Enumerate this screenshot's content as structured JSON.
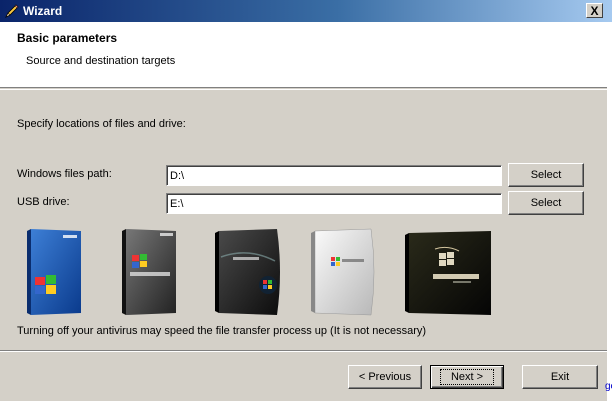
{
  "window": {
    "title": "Wizard",
    "close_label": "X"
  },
  "header": {
    "title": "Basic parameters",
    "subtitle": "Source and destination targets"
  },
  "instructions": "Specify locations of files and drive:",
  "fields": {
    "windows_path": {
      "label": "Windows files path:",
      "value": "D:\\"
    },
    "usb_drive": {
      "label": "USB drive:",
      "value": "E:\\"
    }
  },
  "select_label": "Select",
  "boxes": [
    {
      "name": "windows-xp-box",
      "lettering": "Windows XP"
    },
    {
      "name": "windows-server-2003-box",
      "lettering": "Windows Server 2003"
    },
    {
      "name": "windows-vista-box",
      "lettering": "Windows Vista"
    },
    {
      "name": "windows-server-2008-box",
      "lettering": "Windows Server 2008"
    },
    {
      "name": "windows-7-box",
      "lettering": "Windows 7"
    }
  ],
  "note": "Turning off your antivirus may speed the file transfer process up (It is not necessary)",
  "buttons": {
    "previous": "< Previous",
    "next": "Next >",
    "exit": "Exit"
  },
  "edge_fragment": "ge",
  "colors": {
    "title_start": "#0a246a",
    "title_end": "#a6caf0",
    "dialog_bg": "#d4d0c8"
  },
  "icons": {
    "title": "pencil-icon"
  }
}
